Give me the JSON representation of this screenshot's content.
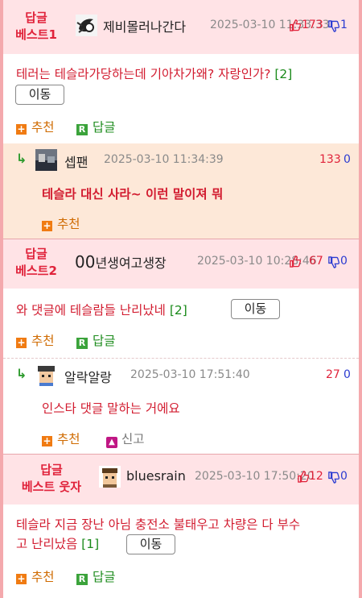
{
  "comments": [
    {
      "badge_line1": "답글",
      "badge_line2": "베스트1",
      "nick": "제비몰러나간다",
      "date": "2025-03-10 11:33:33",
      "up": "173",
      "down": "1",
      "text": "테러는 테슬라가당하는데 기아차가왜? 자랑인가?",
      "reply_count": "[2]",
      "move_label": "이동",
      "recommend_label": "추천",
      "reply_label": "답글"
    },
    {
      "nick": "셉팬",
      "date": "2025-03-10 11:34:39",
      "up": "133",
      "down": "0",
      "text": "테슬라 대신 사라~ 이런 말이져 뭐",
      "recommend_label": "추천"
    },
    {
      "badge_line1": "답글",
      "badge_line2": "베스트2",
      "nick": "00년생여고생장",
      "nick_prefix": "00",
      "nick_rest": "년생여고생장",
      "date": "2025-03-10 10:28:46",
      "up": "67",
      "down": "0",
      "text": "와 댓글에 테슬람들 난리났네",
      "reply_count": "[2]",
      "move_label": "이동",
      "recommend_label": "추천",
      "reply_label": "답글"
    },
    {
      "nick": "알락알랑",
      "date": "2025-03-10 17:51:40",
      "up": "27",
      "down": "0",
      "text": "인스타 댓글 말하는 거에요",
      "recommend_label": "추천",
      "report_label": "신고"
    },
    {
      "badge_line1": "답글",
      "badge_line2": "베스트 웃자",
      "nick": "bluesrain",
      "date": "2025-03-10 17:50:20",
      "up": "12",
      "down": "0",
      "text_line1": "테슬라 지금 장난 아님 충전소 불태우고 차량은 다 부수",
      "text_line2": "고 난리났음",
      "reply_count": "[1]",
      "move_label": "이동",
      "recommend_label": "추천",
      "reply_label": "답글"
    }
  ],
  "colors": {
    "border": "#f4a9ad",
    "header_bg": "#ffe3e6",
    "reply_bg": "#fde8d8",
    "badge": "#e0223a",
    "text": "#d21b2f",
    "up": "#e0223a",
    "down": "#2b3bd1",
    "recommend": "#cf6a00",
    "reply": "#1e8c1e"
  },
  "icons": [
    "reply-arrow-icon",
    "thumb-up-icon",
    "thumb-down-icon",
    "plus-icon",
    "reply-r-icon",
    "report-icon"
  ]
}
